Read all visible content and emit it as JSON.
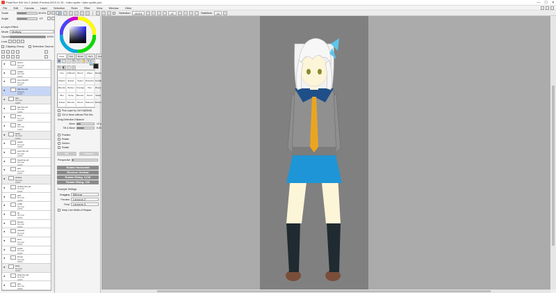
{
  "window": {
    "title": "PaintTool SAI Ver.2 (64bit) Preview.2023.11.30 - Kaho sprite / kaho sprite.psd",
    "controls": [
      "—",
      "☐",
      "✕"
    ]
  },
  "menu": [
    "File",
    "Edit",
    "Canvas",
    "Layer",
    "Selection",
    "Ruler",
    "Filter",
    "View",
    "Window",
    "Other"
  ],
  "toolbar": {
    "selection_label": "Selection",
    "zoom": "49.6%",
    "angle": "+0°",
    "stabilizer_label": "Stabilizer",
    "stabilizer_value": "15"
  },
  "left_panel": {
    "scale_label": "Scale",
    "scale_value": "49.6%",
    "angle_label": "Angle",
    "angle_value": "+0°",
    "layer_effect": "Layer Effect",
    "mode_label": "Mode",
    "mode_value": "Multiply",
    "opacity_label": "Opacity",
    "opacity_value": "100%",
    "lock_label": "Lock",
    "clipping_label": "Clipping Group",
    "selsource_label": "Selection Source"
  },
  "layers": [
    {
      "name": "Grid 1",
      "mode": "Normal",
      "op": "100%",
      "type": "layer"
    },
    {
      "name": "outline",
      "mode": "Normal",
      "op": "100%",
      "type": "layer"
    },
    {
      "name": "eyes sketch",
      "mode": "Normal",
      "op": "100%",
      "type": "layer"
    },
    {
      "name": "hair line art",
      "mode": "Multiply",
      "op": "100%",
      "type": "layer",
      "selected": true
    },
    {
      "name": "hair",
      "mode": "Normal",
      "op": "100%",
      "type": "folder"
    },
    {
      "name": "hair line art",
      "mode": "Normal",
      "op": "100%",
      "type": "layer"
    },
    {
      "name": "bow",
      "mode": "Normal",
      "op": "100%",
      "type": "layer"
    },
    {
      "name": "hair",
      "mode": "Normal",
      "op": "100%",
      "type": "layer"
    },
    {
      "name": "head",
      "mode": "Normal",
      "op": "100%",
      "type": "folder"
    },
    {
      "name": "pupils",
      "mode": "Normal",
      "op": "100%",
      "type": "layer"
    },
    {
      "name": "eyes line art",
      "mode": "Normal",
      "op": "100%",
      "type": "layer"
    },
    {
      "name": "head line art",
      "mode": "Normal",
      "op": "100%",
      "type": "layer"
    },
    {
      "name": "skin",
      "mode": "Normal",
      "op": "100%",
      "type": "layer"
    },
    {
      "name": "clothes",
      "mode": "Normal",
      "op": "100%",
      "type": "folder"
    },
    {
      "name": "clothes line art",
      "mode": "Normal",
      "op": "100%",
      "type": "layer"
    },
    {
      "name": "skirt",
      "mode": "Normal",
      "op": "100%",
      "type": "layer"
    },
    {
      "name": "collar",
      "mode": "Normal",
      "op": "100%",
      "type": "layer"
    },
    {
      "name": "tie",
      "mode": "Normal",
      "op": "100%",
      "type": "layer"
    },
    {
      "name": "blouse",
      "mode": "Normal",
      "op": "100%",
      "type": "layer"
    },
    {
      "name": "sweater",
      "mode": "Normal",
      "op": "100%",
      "type": "layer"
    },
    {
      "name": "shirt",
      "mode": "Normal",
      "op": "100%",
      "type": "layer"
    },
    {
      "name": "socks",
      "mode": "Normal",
      "op": "100%",
      "type": "layer"
    },
    {
      "name": "shoes",
      "mode": "Normal",
      "op": "100%",
      "type": "layer"
    },
    {
      "name": "body",
      "mode": "Normal",
      "op": "100%",
      "type": "folder"
    },
    {
      "name": "body line art",
      "mode": "Normal",
      "op": "100%",
      "type": "layer"
    },
    {
      "name": "skin",
      "mode": "Normal",
      "op": "100%",
      "type": "layer"
    }
  ],
  "tool_tabs": [
    "Layer",
    "Tool",
    "Brush",
    "Ver.1",
    "Option"
  ],
  "brushes": [
    "Pen",
    "AirBrush",
    "Brush",
    "Water",
    "Marker",
    "Marker",
    "Eraser",
    "Select",
    "Deselect",
    "Gradat",
    "Blender",
    "Bucket",
    "Smudge",
    "Wet",
    "Binary",
    "Blur",
    "Spray",
    "Blender",
    "Pencil",
    "Water",
    "Eraser",
    "Blender",
    "Brush",
    "Watercol",
    "Marker"
  ],
  "options": {
    "pick_layer": "Pick Layer by Ctrl+Alt(Shift)",
    "ctrl_move": "Ctrl & Move without Pick Sec",
    "drag_title": "Drag Detection Distance",
    "move_label": "Move",
    "move_value": "10 px",
    "tilt_label": "Tilt & Move",
    "tilt_value": "5.00 px",
    "check_items": [
      "Position",
      "Rotate",
      "Deform",
      "Rotate"
    ],
    "ok": "OK",
    "cancel": "Cancel",
    "perspective_label": "Perspective",
    "btn1": "Rotate Horizontal",
    "btn2": "Reverse Vertical",
    "btn3": "Rotate 90deg. CCW",
    "btn4": "Rotate 90deg. CW",
    "example_title": "Example Settings",
    "drag_label": "Dragging",
    "drag_value": "Bilinear",
    "preview_label": "Preview",
    "preview_value": "Lanczos 2",
    "final_label": "Final",
    "final_value": "Lanczos 3",
    "keep_line": "Keep Line Width of Shapes"
  },
  "colors": {
    "canvas_bg": "#808080",
    "workspace": "#ababab",
    "primary": "#222222",
    "secondary": "#8ed8ee"
  }
}
